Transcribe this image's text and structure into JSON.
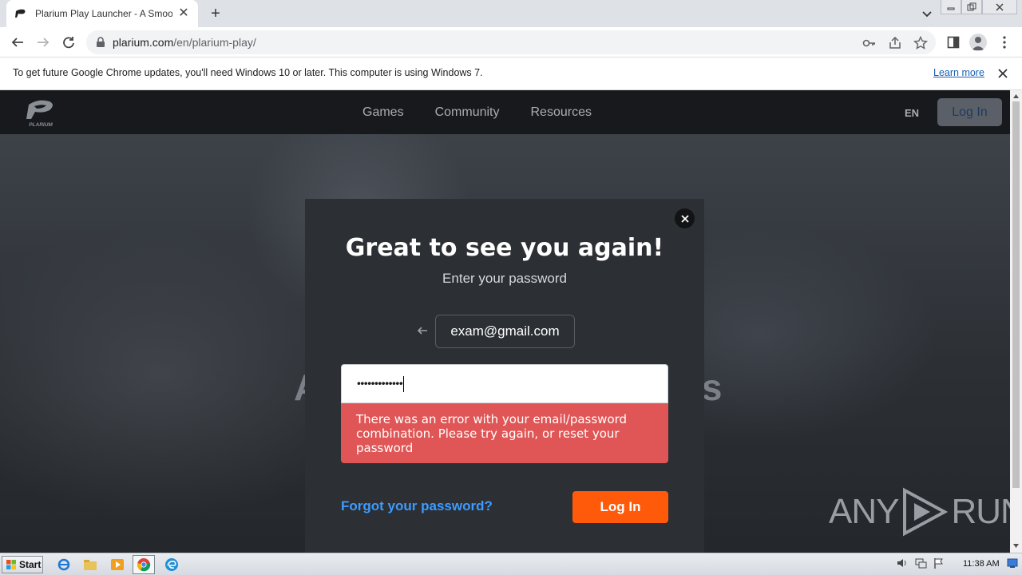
{
  "browser": {
    "tab_title": "Plarium Play Launcher - A Smoother",
    "url_host": "plarium.com",
    "url_path": "/en/plarium-play/"
  },
  "infobar": {
    "message": "To get future Google Chrome updates, you'll need Windows 10 or later. This computer is using Windows 7.",
    "learn_more": "Learn more"
  },
  "site": {
    "nav": [
      "Games",
      "Community",
      "Resources"
    ],
    "lang": "EN",
    "header_login": "Log In",
    "hero_left": "A",
    "hero_right": "rs"
  },
  "modal": {
    "title": "Great to see you again!",
    "subtitle": "Enter your password",
    "email": "exam@gmail.com",
    "password_mask": "•••••••••••••",
    "error": "There was an error with your email/password combination. Please try again, or reset your password",
    "forgot": "Forgot your password?",
    "login": "Log In"
  },
  "watermark": {
    "left": "ANY",
    "right": "RUN"
  },
  "taskbar": {
    "start": "Start",
    "clock": "11:38 AM"
  },
  "colors": {
    "accent_orange": "#ff5a0a",
    "error_red": "#e05656",
    "link_blue": "#3d9bff",
    "modal_bg": "#2c2f33"
  }
}
